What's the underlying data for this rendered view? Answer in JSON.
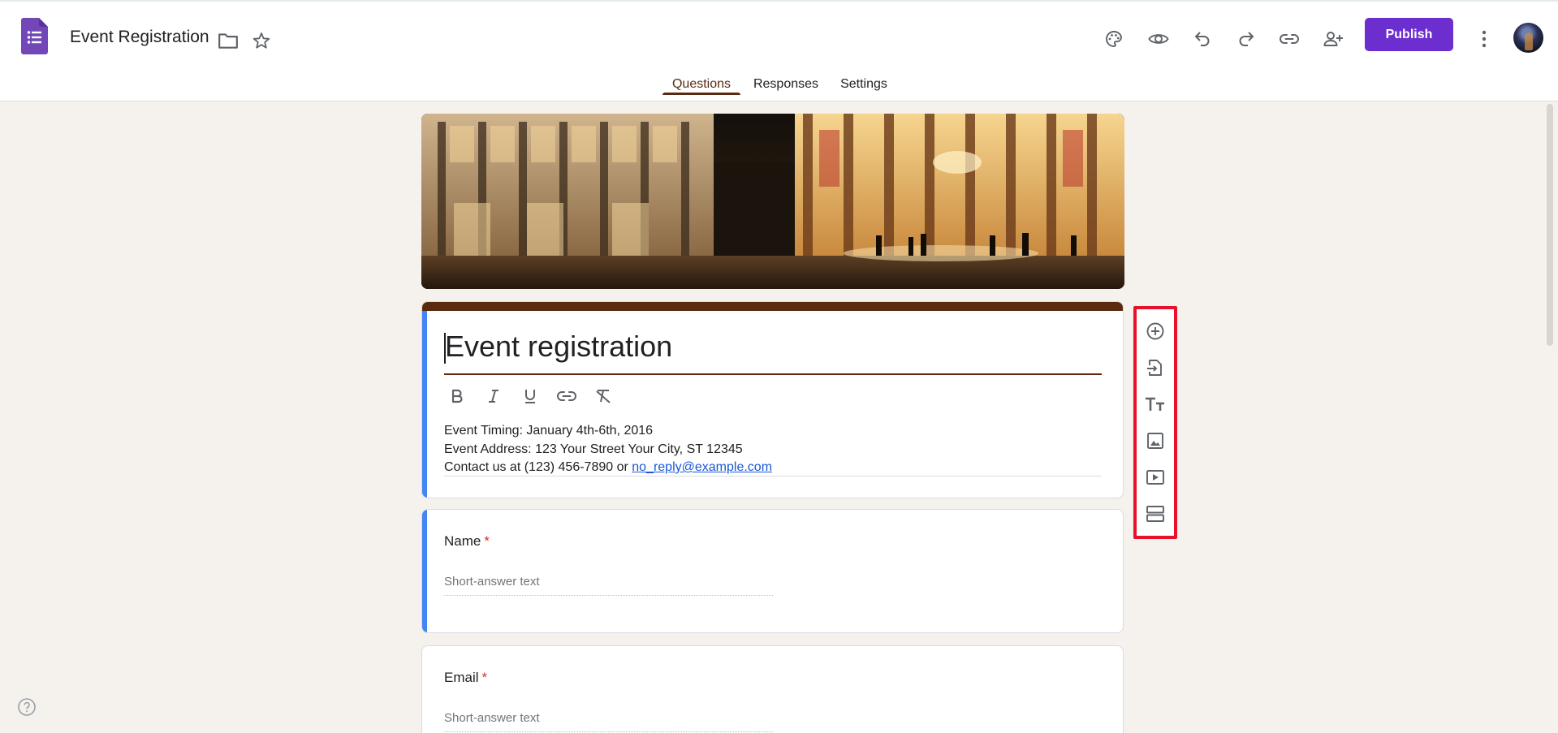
{
  "app": {
    "doc_title": "Event Registration",
    "brand_color": "#6c2ecf",
    "accent_color": "#5b2a0e"
  },
  "header": {
    "icons": [
      "folder-icon",
      "star-icon",
      "palette-icon",
      "preview-icon",
      "undo-icon",
      "redo-icon",
      "link-icon",
      "add-collaborator-icon",
      "more-vert-icon"
    ],
    "publish_label": "Publish"
  },
  "tabs": [
    {
      "label": "Questions",
      "active": true
    },
    {
      "label": "Responses",
      "active": false
    },
    {
      "label": "Settings",
      "active": false
    }
  ],
  "form": {
    "title": "Event registration",
    "format_icons": [
      "bold-icon",
      "italic-icon",
      "underline-icon",
      "insert-link-icon",
      "clear-format-icon"
    ],
    "description": {
      "line1": "Event Timing: January 4th-6th, 2016",
      "line2": "Event Address: 123 Your Street Your City, ST 12345",
      "line3_prefix": "Contact us at (123) 456-7890 or ",
      "email": "no_reply@example.com"
    }
  },
  "questions": [
    {
      "label": "Name",
      "required_mark": "*",
      "placeholder": "Short-answer text"
    },
    {
      "label": "Email",
      "required_mark": "*",
      "placeholder": "Short-answer text"
    }
  ],
  "side_toolbar": {
    "highlight_color": "#e8102a",
    "items": [
      "add-question-icon",
      "import-questions-icon",
      "add-title-icon",
      "add-image-icon",
      "add-video-icon",
      "add-section-icon"
    ]
  }
}
